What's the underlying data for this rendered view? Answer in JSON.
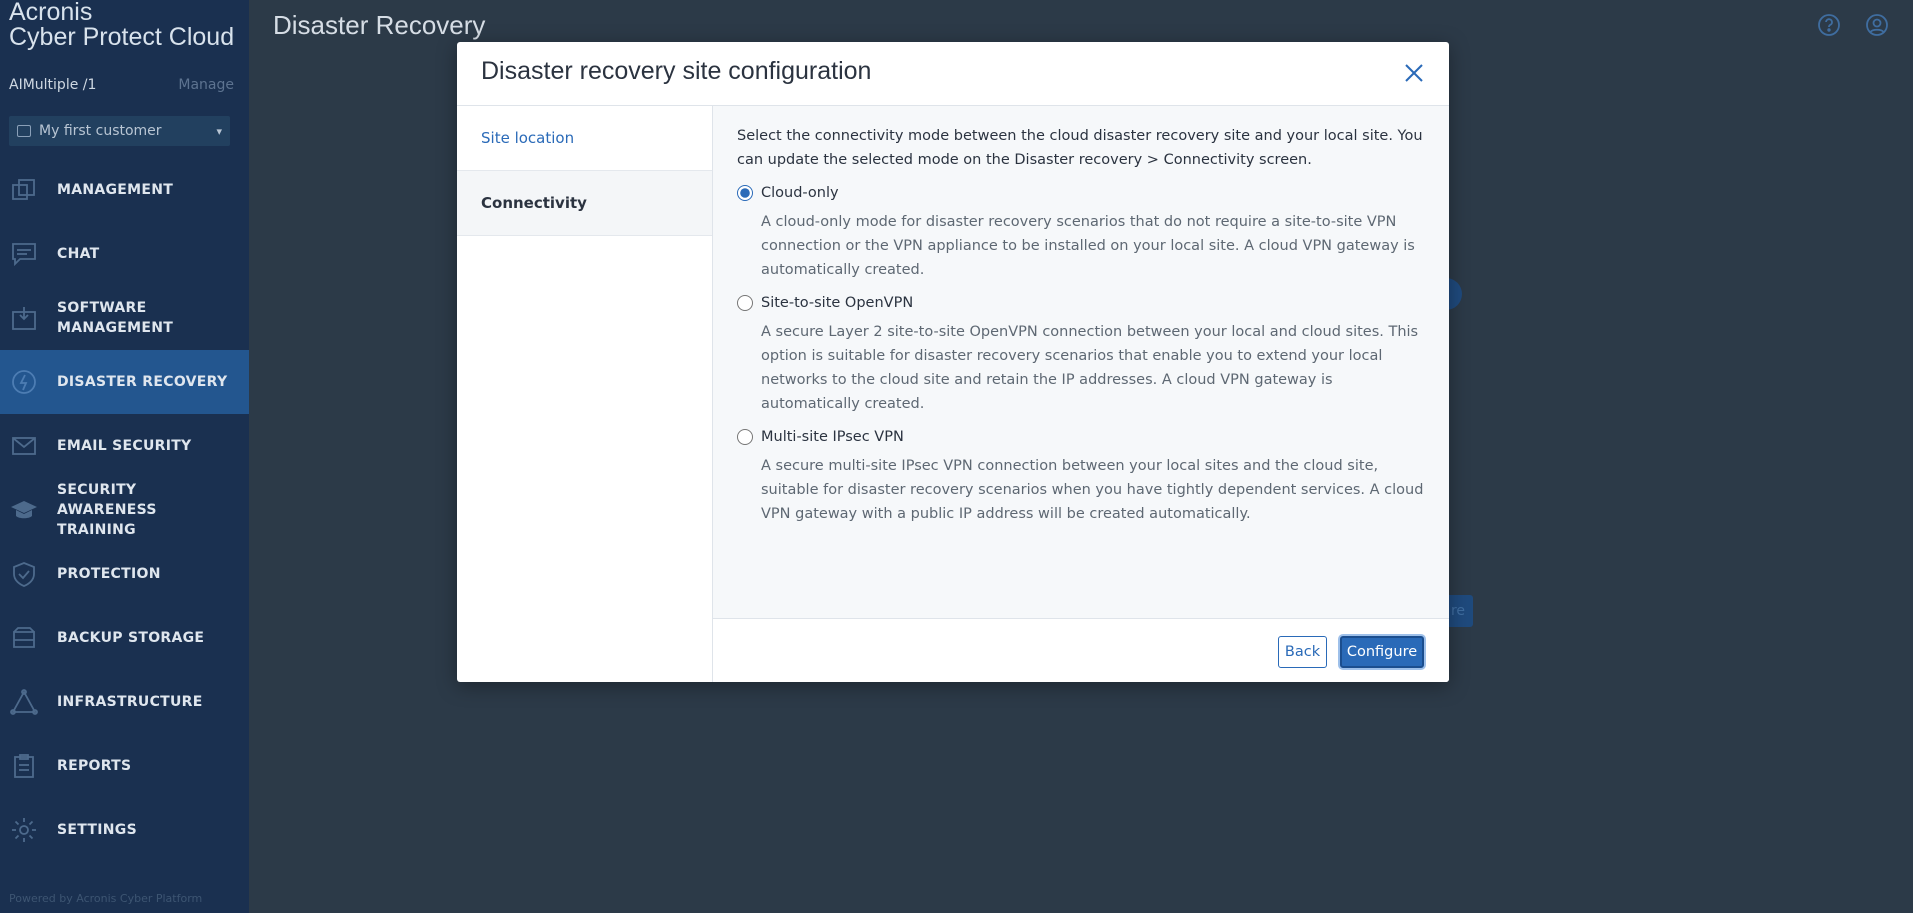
{
  "brand": {
    "line1": "Acronis",
    "line2": "Cyber Protect Cloud"
  },
  "tenant": {
    "name": "AIMultiple /1",
    "manage_label": "Manage"
  },
  "customer_select": {
    "value": "My first customer"
  },
  "nav": {
    "items": [
      {
        "label": "MANAGEMENT",
        "icon": "management-icon",
        "active": false
      },
      {
        "label": "CHAT",
        "icon": "chat-icon",
        "active": false
      },
      {
        "label": "SOFTWARE MANAGEMENT",
        "icon": "software-icon",
        "active": false
      },
      {
        "label": "DISASTER RECOVERY",
        "icon": "disaster-recovery-icon",
        "active": true
      },
      {
        "label": "EMAIL SECURITY",
        "icon": "email-icon",
        "active": false
      },
      {
        "label": "SECURITY AWARENESS TRAINING",
        "icon": "training-icon",
        "active": false
      },
      {
        "label": "PROTECTION",
        "icon": "shield-icon",
        "active": false
      },
      {
        "label": "BACKUP STORAGE",
        "icon": "storage-icon",
        "active": false
      },
      {
        "label": "INFRASTRUCTURE",
        "icon": "infrastructure-icon",
        "active": false
      },
      {
        "label": "REPORTS",
        "icon": "reports-icon",
        "active": false
      },
      {
        "label": "SETTINGS",
        "icon": "gear-icon",
        "active": false
      }
    ]
  },
  "powered_by": "Powered by Acronis Cyber Platform",
  "page": {
    "title": "Disaster Recovery"
  },
  "background_button": {
    "label": "re"
  },
  "dialog": {
    "title": "Disaster recovery site configuration",
    "steps": [
      "Site location",
      "Connectivity"
    ],
    "intro": "Select the connectivity mode between the cloud disaster recovery site and your local site. You can update the selected mode on the Disaster recovery > Connectivity screen.",
    "options": [
      {
        "label": "Cloud-only",
        "description": "A cloud-only mode for disaster recovery scenarios that do not require a site-to-site VPN connection or the VPN appliance to be installed on your local site. A cloud VPN gateway is automatically created.",
        "selected": true
      },
      {
        "label": "Site-to-site OpenVPN",
        "description": "A secure Layer 2 site-to-site OpenVPN connection between your local and cloud sites. This option is suitable for disaster recovery scenarios that enable you to extend your local networks to the cloud site and retain the IP addresses. A cloud VPN gateway is automatically created.",
        "selected": false
      },
      {
        "label": "Multi-site IPsec VPN",
        "description": "A secure multi-site IPsec VPN connection between your local sites and the cloud site, suitable for disaster recovery scenarios when you have tightly dependent services. A cloud VPN gateway with a public IP address will be created automatically.",
        "selected": false
      }
    ],
    "back_label": "Back",
    "configure_label": "Configure"
  },
  "colors": {
    "accent": "#2a6ab8",
    "sidebar": "#1a3050",
    "active_nav": "#23568f"
  }
}
